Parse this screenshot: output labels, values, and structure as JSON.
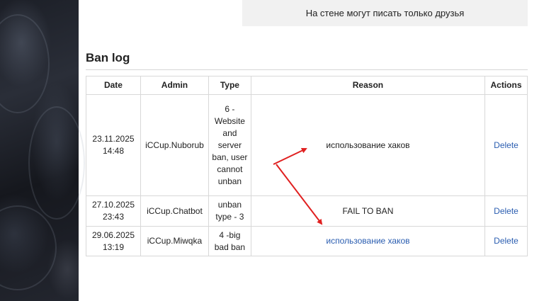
{
  "wall_notice": "На стене могут писать только друзья",
  "ban_log": {
    "title": "Ban log",
    "columns": [
      "Date",
      "Admin",
      "Type",
      "Reason",
      "Actions"
    ],
    "rows": [
      {
        "date_day": "23.11.2025",
        "date_time": "14:48",
        "admin": "iCCup.Nuborub",
        "type": "6 - Website and server ban, user cannot unban",
        "reason": "использование хаков",
        "action": "Delete"
      },
      {
        "date_day": "27.10.2025",
        "date_time": "23:43",
        "admin": "iCCup.Chatbot",
        "type": "unban type - 3",
        "reason": "FAIL TO BAN",
        "action": "Delete"
      },
      {
        "date_day": "29.06.2025",
        "date_time": "13:19",
        "admin": "iCCup.Miwqka",
        "type": "4 -big bad ban",
        "reason": "использование хаков",
        "action": "Delete"
      }
    ]
  },
  "colors": {
    "link": "#2a5db0",
    "annotation_arrow": "#e02020",
    "notice_bg": "#f1f1f1"
  }
}
